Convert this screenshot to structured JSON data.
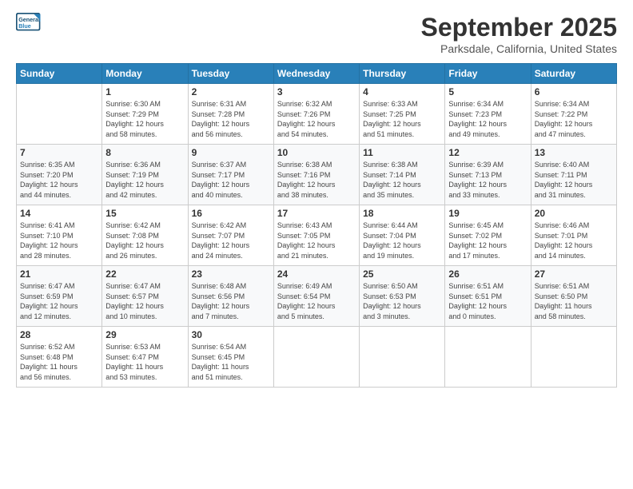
{
  "logo": {
    "line1": "General",
    "line2": "Blue"
  },
  "title": "September 2025",
  "location": "Parksdale, California, United States",
  "days_header": [
    "Sunday",
    "Monday",
    "Tuesday",
    "Wednesday",
    "Thursday",
    "Friday",
    "Saturday"
  ],
  "weeks": [
    [
      {
        "day": "",
        "info": ""
      },
      {
        "day": "1",
        "info": "Sunrise: 6:30 AM\nSunset: 7:29 PM\nDaylight: 12 hours\nand 58 minutes."
      },
      {
        "day": "2",
        "info": "Sunrise: 6:31 AM\nSunset: 7:28 PM\nDaylight: 12 hours\nand 56 minutes."
      },
      {
        "day": "3",
        "info": "Sunrise: 6:32 AM\nSunset: 7:26 PM\nDaylight: 12 hours\nand 54 minutes."
      },
      {
        "day": "4",
        "info": "Sunrise: 6:33 AM\nSunset: 7:25 PM\nDaylight: 12 hours\nand 51 minutes."
      },
      {
        "day": "5",
        "info": "Sunrise: 6:34 AM\nSunset: 7:23 PM\nDaylight: 12 hours\nand 49 minutes."
      },
      {
        "day": "6",
        "info": "Sunrise: 6:34 AM\nSunset: 7:22 PM\nDaylight: 12 hours\nand 47 minutes."
      }
    ],
    [
      {
        "day": "7",
        "info": "Sunrise: 6:35 AM\nSunset: 7:20 PM\nDaylight: 12 hours\nand 44 minutes."
      },
      {
        "day": "8",
        "info": "Sunrise: 6:36 AM\nSunset: 7:19 PM\nDaylight: 12 hours\nand 42 minutes."
      },
      {
        "day": "9",
        "info": "Sunrise: 6:37 AM\nSunset: 7:17 PM\nDaylight: 12 hours\nand 40 minutes."
      },
      {
        "day": "10",
        "info": "Sunrise: 6:38 AM\nSunset: 7:16 PM\nDaylight: 12 hours\nand 38 minutes."
      },
      {
        "day": "11",
        "info": "Sunrise: 6:38 AM\nSunset: 7:14 PM\nDaylight: 12 hours\nand 35 minutes."
      },
      {
        "day": "12",
        "info": "Sunrise: 6:39 AM\nSunset: 7:13 PM\nDaylight: 12 hours\nand 33 minutes."
      },
      {
        "day": "13",
        "info": "Sunrise: 6:40 AM\nSunset: 7:11 PM\nDaylight: 12 hours\nand 31 minutes."
      }
    ],
    [
      {
        "day": "14",
        "info": "Sunrise: 6:41 AM\nSunset: 7:10 PM\nDaylight: 12 hours\nand 28 minutes."
      },
      {
        "day": "15",
        "info": "Sunrise: 6:42 AM\nSunset: 7:08 PM\nDaylight: 12 hours\nand 26 minutes."
      },
      {
        "day": "16",
        "info": "Sunrise: 6:42 AM\nSunset: 7:07 PM\nDaylight: 12 hours\nand 24 minutes."
      },
      {
        "day": "17",
        "info": "Sunrise: 6:43 AM\nSunset: 7:05 PM\nDaylight: 12 hours\nand 21 minutes."
      },
      {
        "day": "18",
        "info": "Sunrise: 6:44 AM\nSunset: 7:04 PM\nDaylight: 12 hours\nand 19 minutes."
      },
      {
        "day": "19",
        "info": "Sunrise: 6:45 AM\nSunset: 7:02 PM\nDaylight: 12 hours\nand 17 minutes."
      },
      {
        "day": "20",
        "info": "Sunrise: 6:46 AM\nSunset: 7:01 PM\nDaylight: 12 hours\nand 14 minutes."
      }
    ],
    [
      {
        "day": "21",
        "info": "Sunrise: 6:47 AM\nSunset: 6:59 PM\nDaylight: 12 hours\nand 12 minutes."
      },
      {
        "day": "22",
        "info": "Sunrise: 6:47 AM\nSunset: 6:57 PM\nDaylight: 12 hours\nand 10 minutes."
      },
      {
        "day": "23",
        "info": "Sunrise: 6:48 AM\nSunset: 6:56 PM\nDaylight: 12 hours\nand 7 minutes."
      },
      {
        "day": "24",
        "info": "Sunrise: 6:49 AM\nSunset: 6:54 PM\nDaylight: 12 hours\nand 5 minutes."
      },
      {
        "day": "25",
        "info": "Sunrise: 6:50 AM\nSunset: 6:53 PM\nDaylight: 12 hours\nand 3 minutes."
      },
      {
        "day": "26",
        "info": "Sunrise: 6:51 AM\nSunset: 6:51 PM\nDaylight: 12 hours\nand 0 minutes."
      },
      {
        "day": "27",
        "info": "Sunrise: 6:51 AM\nSunset: 6:50 PM\nDaylight: 11 hours\nand 58 minutes."
      }
    ],
    [
      {
        "day": "28",
        "info": "Sunrise: 6:52 AM\nSunset: 6:48 PM\nDaylight: 11 hours\nand 56 minutes."
      },
      {
        "day": "29",
        "info": "Sunrise: 6:53 AM\nSunset: 6:47 PM\nDaylight: 11 hours\nand 53 minutes."
      },
      {
        "day": "30",
        "info": "Sunrise: 6:54 AM\nSunset: 6:45 PM\nDaylight: 11 hours\nand 51 minutes."
      },
      {
        "day": "",
        "info": ""
      },
      {
        "day": "",
        "info": ""
      },
      {
        "day": "",
        "info": ""
      },
      {
        "day": "",
        "info": ""
      }
    ]
  ]
}
